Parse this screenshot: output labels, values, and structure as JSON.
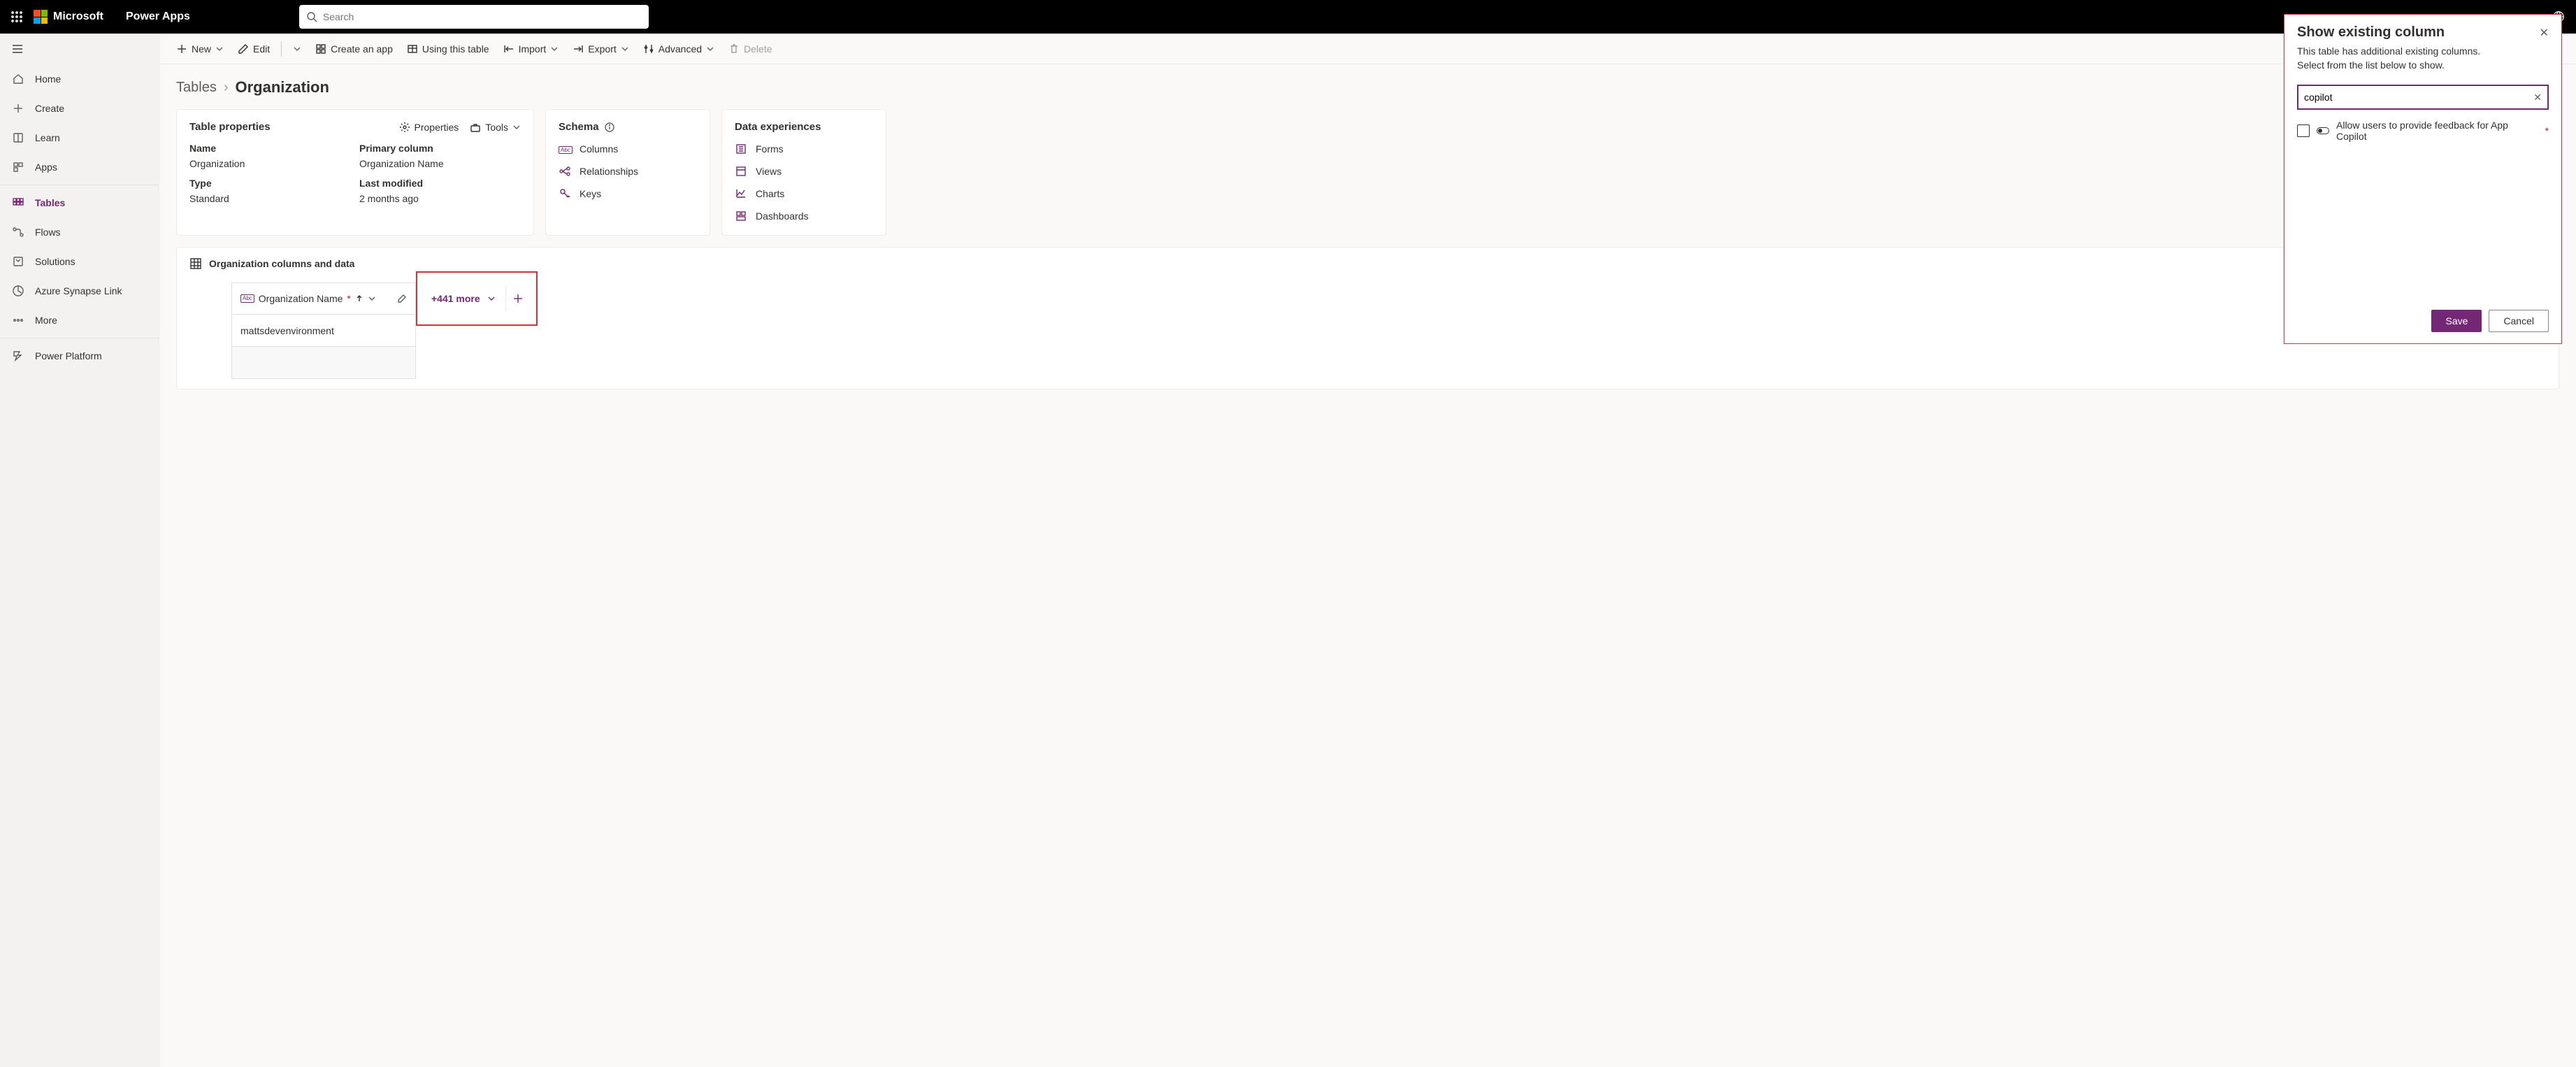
{
  "header": {
    "brand": "Microsoft",
    "app_name": "Power Apps",
    "search_placeholder": "Search"
  },
  "sidebar": {
    "items": [
      {
        "label": "Home"
      },
      {
        "label": "Create"
      },
      {
        "label": "Learn"
      },
      {
        "label": "Apps"
      },
      {
        "label": "Tables"
      },
      {
        "label": "Flows"
      },
      {
        "label": "Solutions"
      },
      {
        "label": "Azure Synapse Link"
      },
      {
        "label": "More"
      },
      {
        "label": "Power Platform"
      }
    ]
  },
  "cmdbar": {
    "new": "New",
    "edit": "Edit",
    "create_app": "Create an app",
    "using_table": "Using this table",
    "import": "Import",
    "export": "Export",
    "advanced": "Advanced",
    "delete": "Delete"
  },
  "breadcrumb": {
    "root": "Tables",
    "current": "Organization"
  },
  "props": {
    "title": "Table properties",
    "actions": {
      "properties": "Properties",
      "tools": "Tools"
    },
    "name_label": "Name",
    "name_value": "Organization",
    "primary_label": "Primary column",
    "primary_value": "Organization Name",
    "type_label": "Type",
    "type_value": "Standard",
    "modified_label": "Last modified",
    "modified_value": "2 months ago"
  },
  "schema": {
    "title": "Schema",
    "items": [
      "Columns",
      "Relationships",
      "Keys"
    ]
  },
  "experiences": {
    "title": "Data experiences",
    "items": [
      "Forms",
      "Views",
      "Charts",
      "Dashboards"
    ]
  },
  "coldata": {
    "title": "Organization columns and data",
    "column_name": "Organization Name",
    "more": "+441 more",
    "row0": "mattsdevenvironment"
  },
  "panel": {
    "title": "Show existing column",
    "sub1": "This table has additional existing columns.",
    "sub2": "Select from the list below to show.",
    "search_value": "copilot",
    "option_label": "Allow users to provide feedback for App Copilot",
    "save": "Save",
    "cancel": "Cancel"
  }
}
